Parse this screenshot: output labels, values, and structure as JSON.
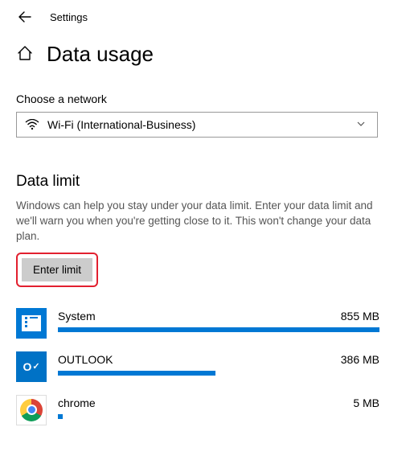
{
  "header": {
    "title": "Settings"
  },
  "page": {
    "title": "Data usage"
  },
  "network": {
    "label": "Choose a network",
    "selected": "Wi-Fi (International-Business)"
  },
  "data_limit": {
    "heading": "Data limit",
    "description": "Windows can help you stay under your data limit. Enter your data limit and we'll warn you when you're getting close to it. This won't change your data plan.",
    "button": "Enter limit"
  },
  "apps": [
    {
      "name": "System",
      "usage": "855 MB",
      "barPercent": 100,
      "iconClass": "icon-system"
    },
    {
      "name": "OUTLOOK",
      "usage": "386 MB",
      "barPercent": 49,
      "iconClass": "icon-outlook"
    },
    {
      "name": "chrome",
      "usage": "5 MB",
      "barPercent": 1.5,
      "iconClass": "icon-chrome"
    }
  ]
}
